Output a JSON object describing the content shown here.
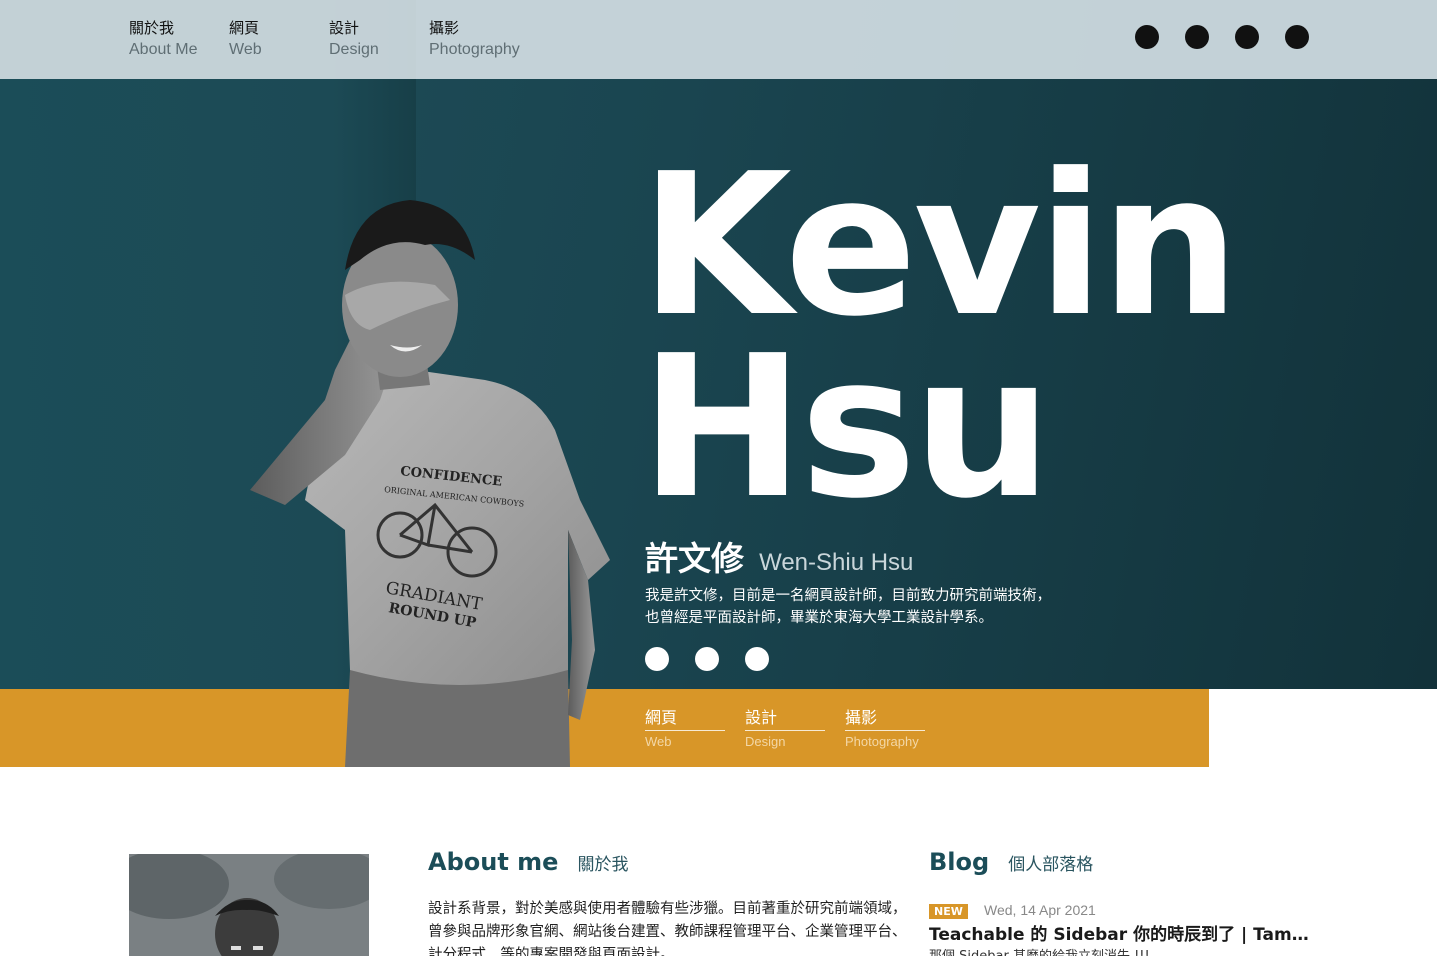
{
  "nav": {
    "items": [
      {
        "zh": "關於我",
        "en": "About Me"
      },
      {
        "zh": "網頁",
        "en": "Web"
      },
      {
        "zh": "設計",
        "en": "Design"
      },
      {
        "zh": "攝影",
        "en": "Photography"
      }
    ],
    "social_icons": [
      "social-icon-1",
      "social-icon-2",
      "social-icon-3",
      "social-icon-4"
    ]
  },
  "hero": {
    "name_line1": "Kevin",
    "name_line2": "Hsu",
    "name_zh": "許文修",
    "name_en": "Wen-Shiu Hsu",
    "intro_line1": "我是許文修，目前是一名網頁設計師，目前致力研究前端技術，",
    "intro_line2": "也曾經是平面設計師，畢業於東海大學工業設計學系。",
    "contact_icons": [
      "contact-icon-1",
      "contact-icon-2",
      "contact-icon-3"
    ],
    "shirt_text": {
      "line1": "CONFIDENCE",
      "line2": "ORIGINAL AMERICAN COWBOYS",
      "line3": "GRADIANT",
      "line4": "ROUND UP"
    }
  },
  "band": {
    "links": [
      {
        "zh": "網頁",
        "en": "Web"
      },
      {
        "zh": "設計",
        "en": "Design"
      },
      {
        "zh": "攝影",
        "en": "Photography"
      }
    ]
  },
  "about": {
    "title_en": "About me",
    "title_zh": "關於我",
    "text": "設計系背景，對於美感與使用者體驗有些涉獵。目前著重於研究前端領域，曾參與品牌形象官網、網站後台建置、教師課程管理平台、企業管理平台、計分程式…等的專案開發與頁面設計。"
  },
  "blog": {
    "title_en": "Blog",
    "title_zh": "個人部落格",
    "post": {
      "badge": "NEW",
      "date": "Wed, 14 Apr 2021",
      "title": "Teachable 的 Sidebar 你的時辰到了 | Tam...",
      "excerpt": "那個 Sidebar 甚麼的給我立刻消失 !!!"
    }
  },
  "colors": {
    "teal_dark": "#12323a",
    "teal": "#1f4f5b",
    "accent_orange": "#d89628",
    "nav_bg": "#d2dee4"
  }
}
